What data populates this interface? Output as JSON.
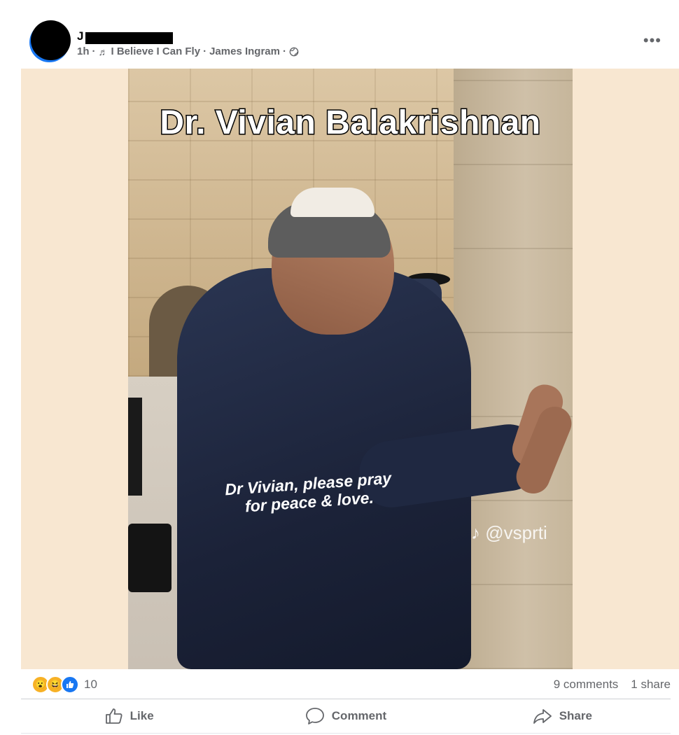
{
  "post": {
    "author_initial": "J",
    "time": "1h",
    "separator": "·",
    "song": "I Believe I Can Fly",
    "artist": "James Ingram",
    "more_label": "•••"
  },
  "media": {
    "title_overlay": "Dr. Vivian Balakrishnan",
    "caption": "Dr Vivian, please pray for peace & love.",
    "watermark": "@vsprti"
  },
  "stats": {
    "reaction_count": "10",
    "comments": "9 comments",
    "shares": "1 share"
  },
  "actions": {
    "like": "Like",
    "comment": "Comment",
    "share": "Share"
  },
  "icons": {
    "music": "music-note-icon",
    "privacy": "globe-icon",
    "mute": "muted-speaker-icon"
  }
}
